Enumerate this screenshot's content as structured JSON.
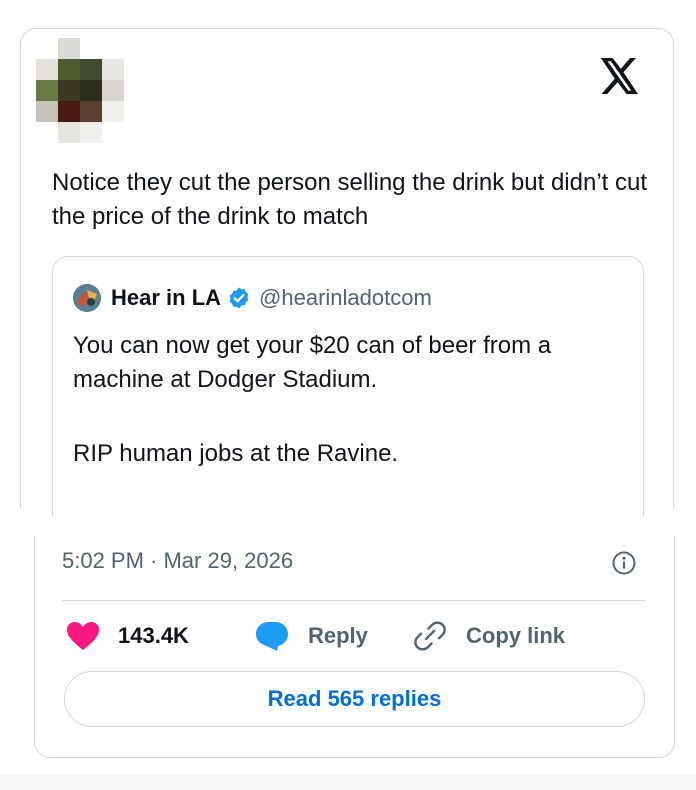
{
  "tweet": {
    "author_name": "",
    "author_handle": "",
    "text": "Notice they cut the person selling the drink but didn’t cut the price of the drink to match",
    "logo_icon": "x-logo-icon"
  },
  "quoted_tweet": {
    "author_name": "Hear in LA",
    "author_handle": "@hearinladotcom",
    "verified": true,
    "text_paragraph_1": "You can now get your $20 can of beer from a machine at Dodger Stadium.",
    "text_paragraph_2": "RIP human jobs at the Ravine."
  },
  "meta": {
    "timestamp": "5:02 PM · Mar 29, 2026",
    "info_icon": "info-icon"
  },
  "actions": {
    "like_count": "143.4K",
    "reply_label": "Reply",
    "copy_link_label": "Copy link"
  },
  "read_replies_label": "Read 565 replies",
  "colors": {
    "like": "#f91880",
    "reply_icon": "#1d9bf0",
    "link": "#006fd6",
    "border": "#cfd9de",
    "secondary_text": "#536471",
    "verified": "#1d9bf0"
  }
}
